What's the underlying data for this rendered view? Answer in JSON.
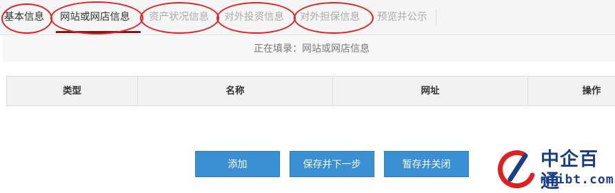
{
  "tabs": [
    {
      "label": "基本信息",
      "state": "done"
    },
    {
      "label": "网站或网店信息",
      "state": "active"
    },
    {
      "label": "资产状况信息",
      "state": "pending"
    },
    {
      "label": "对外投资信息",
      "state": "pending"
    },
    {
      "label": "对外担保信息",
      "state": "pending"
    },
    {
      "label": "预览并公示",
      "state": "pending"
    }
  ],
  "status": {
    "prefix": "正在填录：",
    "current": "网站或网店信息"
  },
  "table": {
    "columns": [
      "类型",
      "名称",
      "网址",
      "操作"
    ],
    "rows": []
  },
  "buttons": {
    "add": "添加",
    "save_next": "保存并下一步",
    "save_close": "暂存并关闭"
  },
  "watermark": {
    "name": "中企百通",
    "domain": "miibt.com"
  },
  "colors": {
    "button": "#3b8fd3",
    "annotation": "#e02020",
    "watermark": "#1a3f8a"
  }
}
